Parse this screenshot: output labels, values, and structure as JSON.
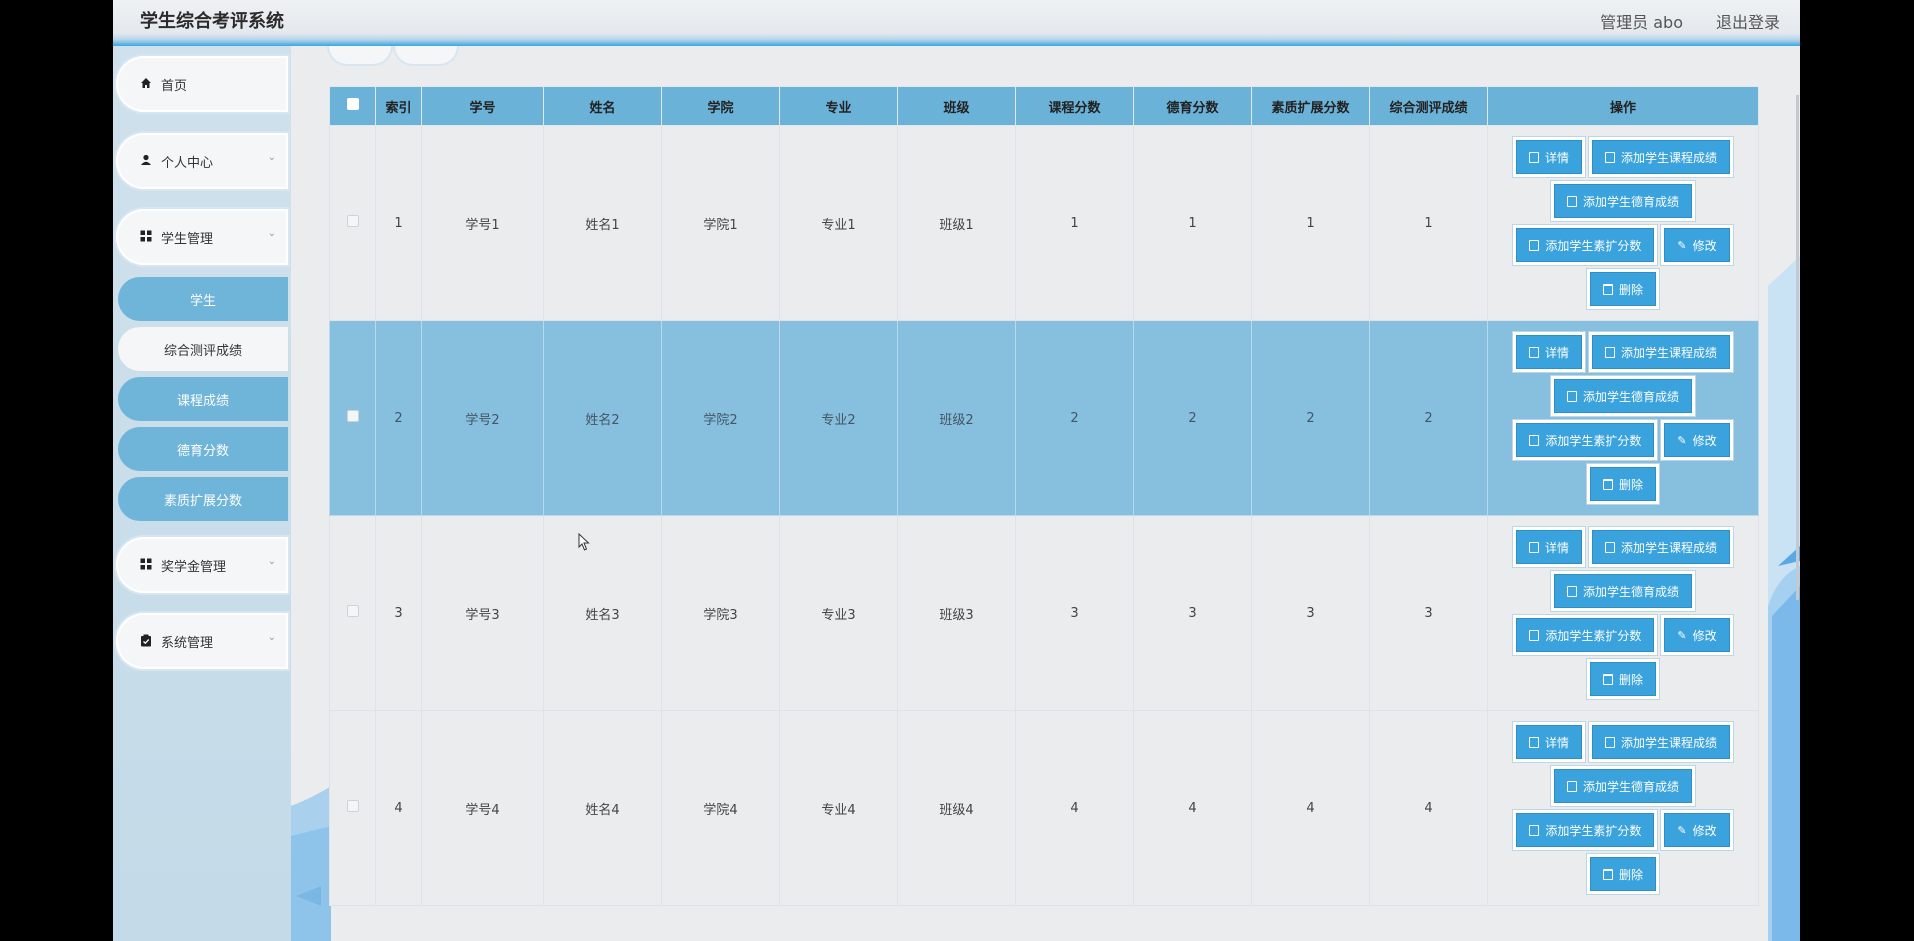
{
  "header": {
    "title": "学生综合考评系统",
    "admin": "管理员 abo",
    "logout": "退出登录"
  },
  "sidebar": {
    "items": [
      {
        "label": "首页",
        "icon": "home-icon"
      },
      {
        "label": "个人中心",
        "icon": "user-icon"
      },
      {
        "label": "学生管理",
        "icon": "grid-icon"
      },
      {
        "label": "奖学金管理",
        "icon": "grid-icon"
      },
      {
        "label": "系统管理",
        "icon": "clipboard-icon"
      }
    ],
    "sub_items": [
      {
        "label": "学生",
        "active": true
      },
      {
        "label": "综合测评成绩",
        "active": false
      },
      {
        "label": "课程成绩",
        "active": true
      },
      {
        "label": "德育分数",
        "active": true
      },
      {
        "label": "素质扩展分数",
        "active": true
      }
    ]
  },
  "table": {
    "columns": [
      "",
      "索引",
      "学号",
      "姓名",
      "学院",
      "专业",
      "班级",
      "课程分数",
      "德育分数",
      "素质扩展分数",
      "综合测评成绩",
      "操作"
    ],
    "rows": [
      {
        "index": "1",
        "id": "学号1",
        "name": "姓名1",
        "college": "学院1",
        "major": "专业1",
        "class": "班级1",
        "course": "1",
        "moral": "1",
        "quality": "1",
        "total": "1"
      },
      {
        "index": "2",
        "id": "学号2",
        "name": "姓名2",
        "college": "学院2",
        "major": "专业2",
        "class": "班级2",
        "course": "2",
        "moral": "2",
        "quality": "2",
        "total": "2"
      },
      {
        "index": "3",
        "id": "学号3",
        "name": "姓名3",
        "college": "学院3",
        "major": "专业3",
        "class": "班级3",
        "course": "3",
        "moral": "3",
        "quality": "3",
        "total": "3"
      },
      {
        "index": "4",
        "id": "学号4",
        "name": "姓名4",
        "college": "学院4",
        "major": "专业4",
        "class": "班级4",
        "course": "4",
        "moral": "4",
        "quality": "4",
        "total": "4"
      }
    ],
    "actions": {
      "detail": "详情",
      "add_course": "添加学生课程成绩",
      "add_moral": "添加学生德育成绩",
      "add_quality": "添加学生素扩分数",
      "edit": "修改",
      "delete": "删除"
    }
  }
}
